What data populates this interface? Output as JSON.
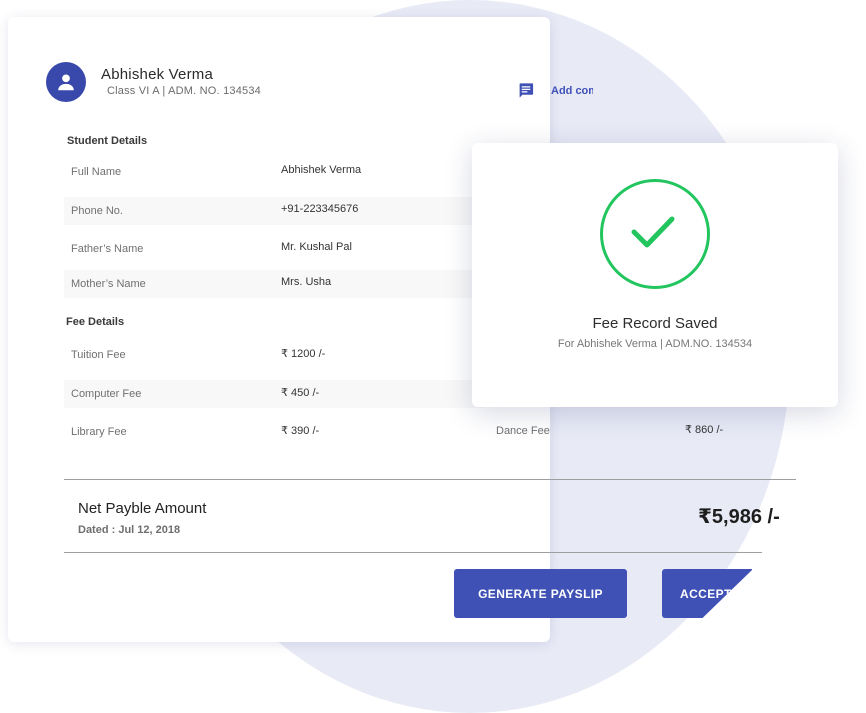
{
  "student": {
    "name": "Abhishek Verma",
    "class_line": "Class VI A  |  ADM. NO. 134534"
  },
  "comment": {
    "label": "Add comment",
    "icon": "comment-icon"
  },
  "student_details": {
    "title": "Student Details",
    "rows": [
      {
        "label": "Full Name",
        "value": "Abhishek Verma"
      },
      {
        "label": "Phone No.",
        "value": "+91-223345676"
      },
      {
        "label": "Father’s Name",
        "value": "Mr. Kushal Pal"
      },
      {
        "label": "Mother’s Name",
        "value": "Mrs. Usha"
      }
    ]
  },
  "fee_details": {
    "title": "Fee Details",
    "rows": [
      {
        "label": "Tuition Fee",
        "value": "₹ 1200 /-"
      },
      {
        "label": "Computer Fee",
        "value": "₹ 450 /-"
      },
      {
        "label": "Library Fee",
        "value": "₹ 390 /-"
      }
    ],
    "extra": {
      "label": "Dance Fee",
      "value": "₹ 860 /-"
    }
  },
  "summary": {
    "net_label": "Net Payble Amount",
    "dated": "Dated : Jul 12, 2018",
    "amount": "₹5,986 /-"
  },
  "buttons": {
    "generate": "GENERATE PAYSLIP",
    "accept": "ACCEPT"
  },
  "modal": {
    "title": "Fee Record Saved",
    "subtitle": "For Abhishek Verma | ADM.NO. 134534"
  },
  "colors": {
    "primary": "#3f51b5",
    "success": "#22c55e",
    "background_blob": "#e8eaf6"
  }
}
